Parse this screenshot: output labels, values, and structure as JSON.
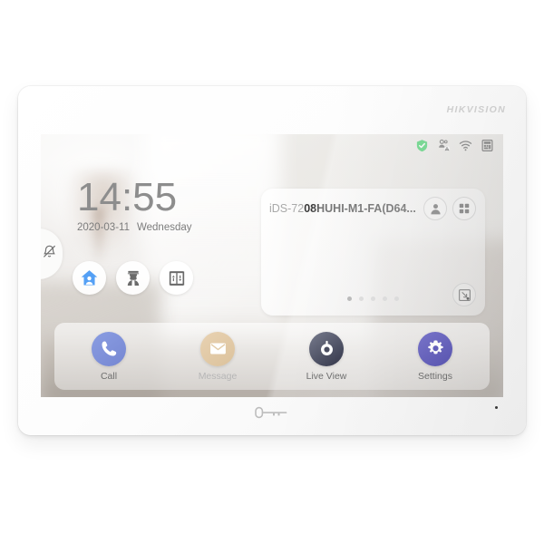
{
  "device": {
    "brand": "HIKVISION",
    "home_button_icon": "key-icon",
    "mic_icon": "microphone-hole"
  },
  "screen": {
    "statusbar": {
      "icons": [
        {
          "name": "security-shield-icon",
          "label": "Protection On",
          "color": "#2ecb5a"
        },
        {
          "name": "do-not-disturb-contacts-icon",
          "label": "Do Not Disturb",
          "color": "#595959"
        },
        {
          "name": "wifi-icon",
          "label": "Wi-Fi",
          "color": "#595959"
        },
        {
          "name": "sd-storage-icon",
          "label": "Storage",
          "color": "#595959"
        }
      ]
    },
    "clock": {
      "time": "14:55",
      "date": "2020-03-11",
      "weekday": "Wednesday"
    },
    "notch": {
      "icon": "bell-mute-icon",
      "label": "Mute"
    },
    "quick_actions": [
      {
        "name": "quick-action-arming",
        "icon": "home-person-icon",
        "label": "Arming",
        "color": "#4e9cf0"
      },
      {
        "name": "quick-action-security-guard",
        "icon": "security-guard-icon",
        "label": "Security Guard",
        "color": "#666666"
      },
      {
        "name": "quick-action-elevator",
        "icon": "elevator-icon",
        "label": "Elevator",
        "color": "#666666"
      }
    ],
    "device_card": {
      "name_prefix": "iDS-72",
      "name_rest": "08HUHI-M1-FA(D64...",
      "full_name": "iDS-7208HUHI-M1-FA(D64...",
      "buttons": [
        {
          "name": "card-contact-button",
          "icon": "person-icon",
          "label": "Contact"
        },
        {
          "name": "card-grid-button",
          "icon": "grid-apps-icon",
          "label": "Apps"
        }
      ],
      "expand_button": {
        "name": "card-expand-button",
        "icon": "expand-screen-icon",
        "label": "Expand"
      },
      "pagination": {
        "count": 5,
        "active_index": 0
      }
    },
    "dock": [
      {
        "name": "dock-call",
        "label": "Call",
        "icon": "phone-icon",
        "color_from": "#8a9de2",
        "color_to": "#7a8cd6",
        "label_dim": false
      },
      {
        "name": "dock-message",
        "label": "Message",
        "icon": "envelope-icon",
        "color_from": "#e6cfae",
        "color_to": "#dcc29c",
        "label_dim": true
      },
      {
        "name": "dock-live-view",
        "label": "Live View",
        "icon": "camera-eye-icon",
        "color_from": "#6b6f82",
        "color_to": "#3c3f4f",
        "label_dim": false
      },
      {
        "name": "dock-settings",
        "label": "Settings",
        "icon": "gear-icon",
        "color_from": "#6f6bc4",
        "color_to": "#5b57b4",
        "label_dim": false
      }
    ]
  }
}
